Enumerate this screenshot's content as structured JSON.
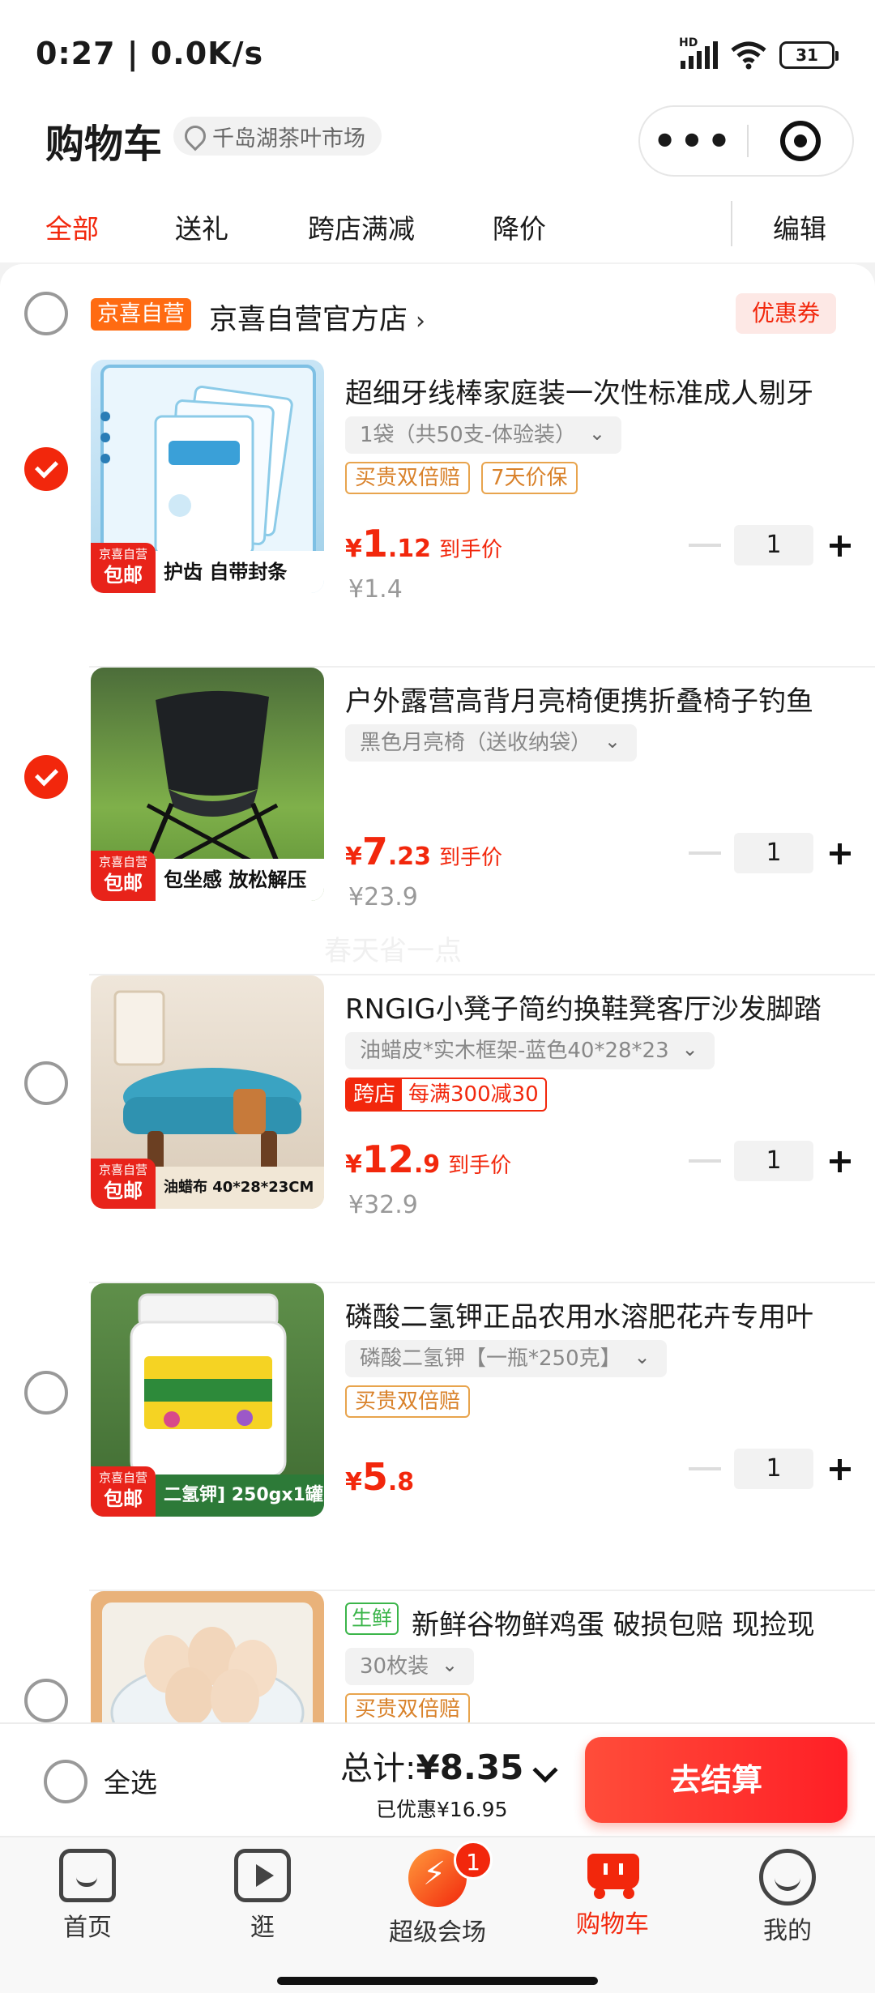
{
  "status": {
    "time": "0:27 | 0.0K/s",
    "network": "HD",
    "battery": "31"
  },
  "header": {
    "title": "购物车",
    "location": "千岛湖茶叶市场",
    "more": "•••"
  },
  "tabs": [
    "全部",
    "送礼",
    "跨店满减",
    "降价"
  ],
  "edit_label": "编辑",
  "shop": {
    "badge": "京喜自营",
    "name": "京喜自营官方店",
    "arrow": "›",
    "coupon": "优惠券"
  },
  "thumb_tag": {
    "top": "京喜自营",
    "bottom": "包邮"
  },
  "items": [
    {
      "checked": true,
      "title": "超细牙线棒家庭装一次性标准成人剔牙",
      "spec": "1袋（共50支-体验装）",
      "badges": [
        "买贵双倍赔",
        "7天价保"
      ],
      "price_int": "1",
      "price_dec": ".12",
      "price_label": "到手价",
      "orig": "¥1.4",
      "qty": "1",
      "banner": "护齿 自带封条"
    },
    {
      "checked": true,
      "title": "户外露营高背月亮椅便携折叠椅子钓鱼",
      "spec": "黑色月亮椅（送收纳袋）",
      "badges": [],
      "price_int": "7",
      "price_dec": ".23",
      "price_label": "到手价",
      "orig": "¥23.9",
      "qty": "1",
      "banner": "包坐感 放松解压"
    },
    {
      "checked": false,
      "title": "RNGIG小凳子简约换鞋凳客厅沙发脚踏",
      "spec": "油蜡皮*实木框架-蓝色40*28*23",
      "promo": {
        "a": "跨店",
        "b": "每满300减30"
      },
      "price_int": "12",
      "price_dec": ".9",
      "price_label": "到手价",
      "orig": "¥32.9",
      "qty": "1",
      "banner": "油蜡布  40*28*23CM"
    },
    {
      "checked": false,
      "title": "磷酸二氢钾正品农用水溶肥花卉专用叶",
      "spec": "磷酸二氢钾【一瓶*250克】",
      "badges": [
        "买贵双倍赔"
      ],
      "price_int": "5",
      "price_dec": ".8",
      "price_label": "",
      "orig": "",
      "qty": "1",
      "banner": "二氢钾] 250gx1罐"
    },
    {
      "checked": false,
      "fresh": "生鲜",
      "title": "新鲜谷物鲜鸡蛋 破损包赔 现捡现",
      "spec": "30枚装",
      "badges": [
        "买贵双倍赔"
      ]
    }
  ],
  "currency": "¥",
  "watermark": "春天省一点",
  "summary": {
    "select_all": "全选",
    "total_label": "总计:",
    "total": "¥8.35",
    "saved": "已优惠¥16.95",
    "checkout": "去结算"
  },
  "nav": [
    {
      "label": "首页",
      "icon": "home-icon"
    },
    {
      "label": "逛",
      "icon": "video-icon"
    },
    {
      "label": "超级会场",
      "icon": "flash-icon",
      "badge": "1"
    },
    {
      "label": "购物车",
      "icon": "cart-icon",
      "active": true
    },
    {
      "label": "我的",
      "icon": "me-icon"
    }
  ],
  "colors": {
    "accent": "#f2270c",
    "badge_orange": "#ff6b12",
    "fresh_green": "#3bb54a"
  }
}
